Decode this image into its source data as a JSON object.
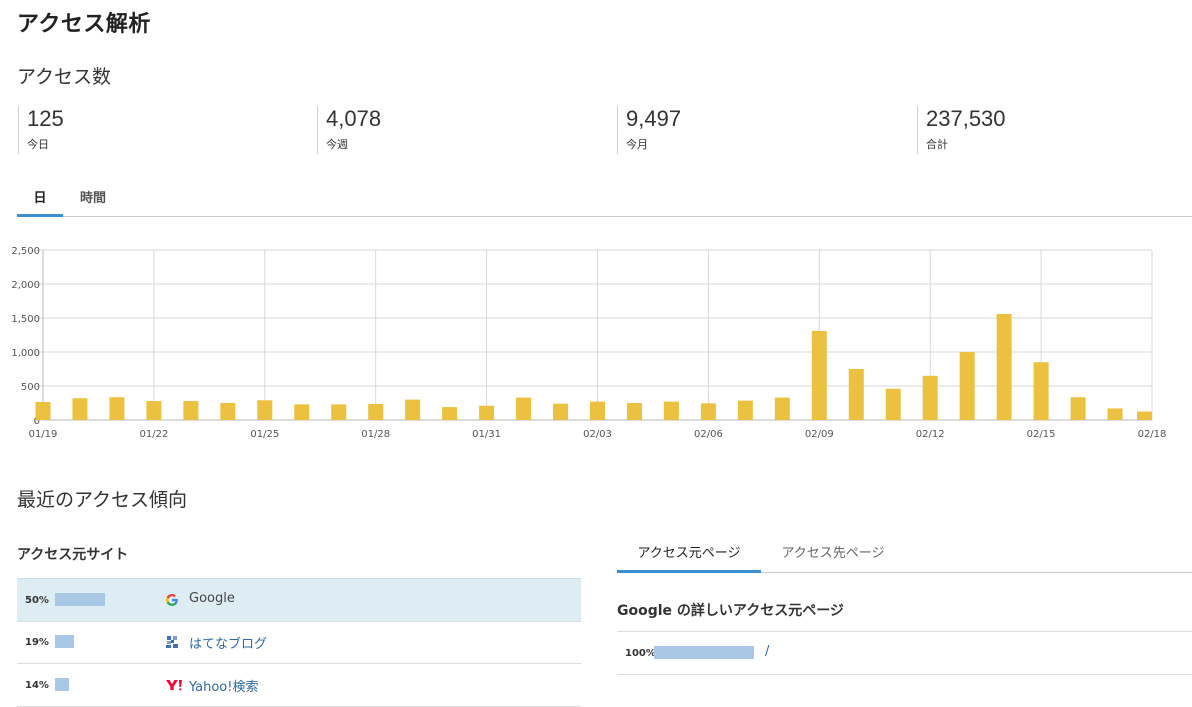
{
  "page": {
    "title": "アクセス解析"
  },
  "access_count": {
    "title": "アクセス数",
    "stats": [
      {
        "value": "125",
        "label": "今日"
      },
      {
        "value": "4,078",
        "label": "今週"
      },
      {
        "value": "9,497",
        "label": "今月"
      },
      {
        "value": "237,530",
        "label": "合計"
      }
    ],
    "tabs": [
      {
        "label": "日",
        "active": true
      },
      {
        "label": "時間",
        "active": false
      }
    ]
  },
  "chart_data": {
    "type": "bar",
    "color": "#ecc13f",
    "ylim": [
      0,
      2500
    ],
    "yticks": [
      "0",
      "500",
      "1,000",
      "1,500",
      "2,000",
      "2,500"
    ],
    "ytick_values": [
      0,
      500,
      1000,
      1500,
      2000,
      2500
    ],
    "categories": [
      "01/19",
      "01/20",
      "01/21",
      "01/22",
      "01/23",
      "01/24",
      "01/25",
      "01/26",
      "01/27",
      "01/28",
      "01/29",
      "01/30",
      "01/31",
      "02/01",
      "02/02",
      "02/03",
      "02/04",
      "02/05",
      "02/06",
      "02/07",
      "02/08",
      "02/09",
      "02/10",
      "02/11",
      "02/12",
      "02/13",
      "02/14",
      "02/15",
      "02/16",
      "02/17",
      "02/18"
    ],
    "xtick_labels": [
      "01/19",
      "01/22",
      "01/25",
      "01/28",
      "01/31",
      "02/03",
      "02/06",
      "02/09",
      "02/12",
      "02/15",
      "02/18"
    ],
    "values": [
      265,
      320,
      335,
      280,
      280,
      250,
      290,
      230,
      230,
      235,
      300,
      190,
      210,
      330,
      240,
      270,
      250,
      270,
      245,
      285,
      330,
      1310,
      750,
      460,
      650,
      1000,
      1560,
      850,
      335,
      170,
      125
    ],
    "grid": true
  },
  "trends": {
    "title": "最近のアクセス傾向",
    "sources_title": "アクセス元サイト",
    "sources": [
      {
        "pct": "50%",
        "share": 0.5,
        "name": "Google",
        "icon": "google-icon"
      },
      {
        "pct": "19%",
        "share": 0.19,
        "name": "はてなブログ",
        "icon": "hatena-blog-icon"
      },
      {
        "pct": "14%",
        "share": 0.14,
        "name": "Yahoo!検索",
        "icon": "yahoo-icon"
      }
    ],
    "page_tabs": [
      {
        "label": "アクセス元ページ",
        "active": true
      },
      {
        "label": "アクセス先ページ",
        "active": false
      }
    ],
    "detail_title": "Google の詳しいアクセス元ページ",
    "detail_rows": [
      {
        "pct": "100%",
        "share": 1.0,
        "path": "/"
      }
    ]
  },
  "colors": {
    "accent": "#3b8fd0",
    "bar": "#ecc13f",
    "share_bar": "#a8c8e6",
    "selected_row": "#deedf3",
    "link": "#2c6aa8"
  }
}
